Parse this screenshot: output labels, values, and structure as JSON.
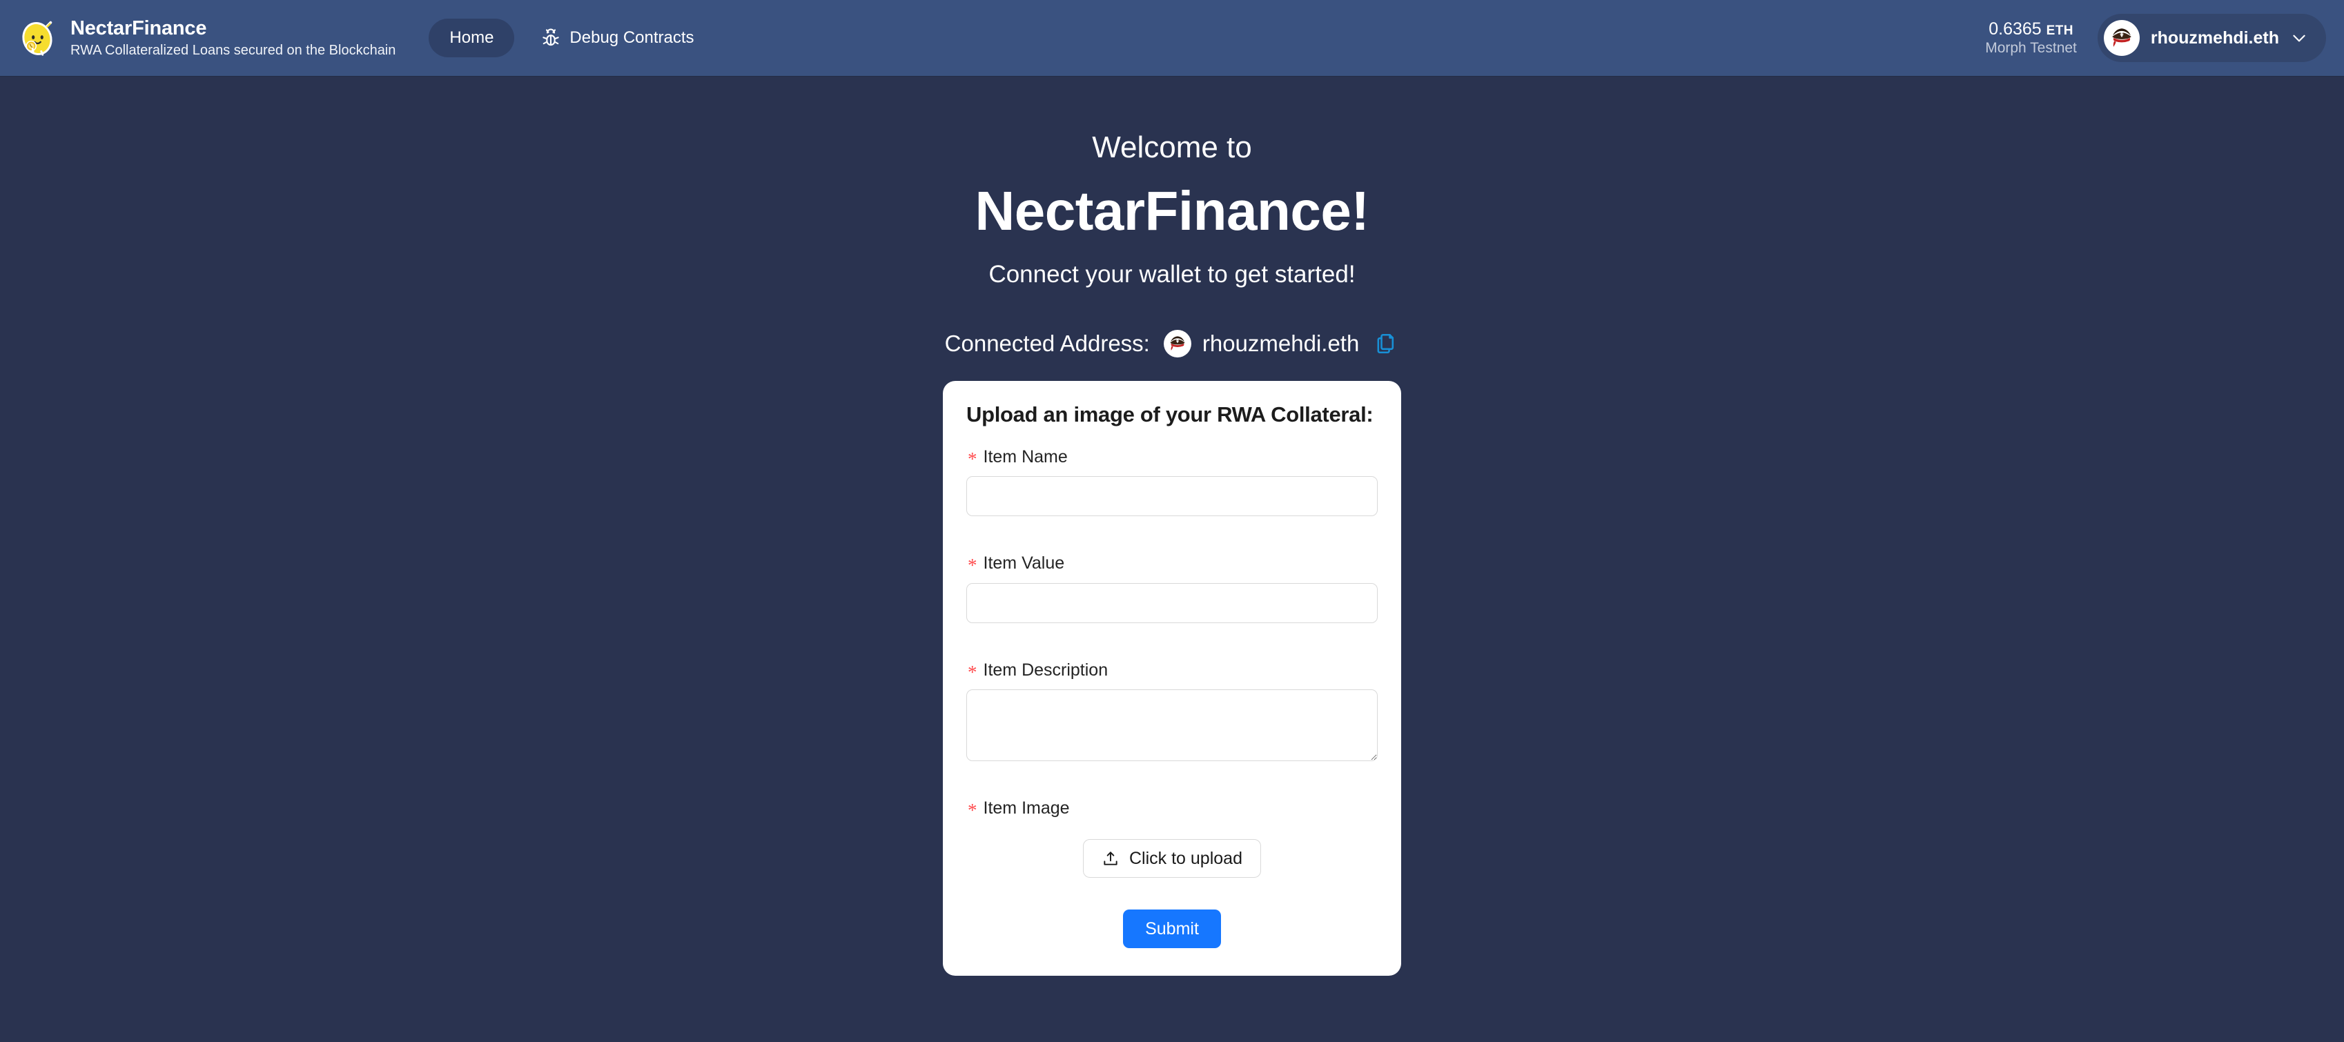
{
  "header": {
    "brand": {
      "logo_icon": "lemon-mascot-logo",
      "title": "NectarFinance",
      "subtitle": "RWA Collateralized Loans secured on the Blockchain"
    },
    "nav": [
      {
        "label": "Home",
        "active": true,
        "icon": null
      },
      {
        "label": "Debug Contracts",
        "active": false,
        "icon": "bug-icon"
      }
    ],
    "balance": {
      "amount": "0.6365",
      "unit": "ETH",
      "network": "Morph Testnet"
    },
    "wallet": {
      "avatar_icon": "pirate-avatar",
      "name": "rhouzmehdi.eth",
      "chevron_icon": "chevron-down-icon"
    }
  },
  "main": {
    "welcome_small": "Welcome to",
    "welcome_big": "NectarFinance!",
    "welcome_tagline": "Connect your wallet to get started!",
    "connected": {
      "label": "Connected Address:",
      "avatar_icon": "pirate-avatar",
      "address": "rhouzmehdi.eth",
      "copy_icon": "copy-icon"
    }
  },
  "form": {
    "title": "Upload an image of your RWA Collateral:",
    "required_marker": "*",
    "fields": [
      {
        "label": "Item Name",
        "value": "",
        "placeholder": "",
        "type": "text"
      },
      {
        "label": "Item Value",
        "value": "",
        "placeholder": "",
        "type": "text"
      },
      {
        "label": "Item Description",
        "value": "",
        "placeholder": "",
        "type": "textarea"
      },
      {
        "label": "Item Image",
        "value": "",
        "placeholder": "",
        "type": "upload"
      }
    ],
    "upload_label": "Click to upload",
    "upload_icon": "upload-icon",
    "submit_label": "Submit"
  },
  "colors": {
    "header_bg": "#3a5280",
    "page_bg": "#2a3350",
    "nav_active_bg": "#2f4168",
    "wallet_pill_bg": "#33466d",
    "primary": "#1677ff",
    "required_red": "#ff4d4f",
    "copy_icon_blue": "#1890d6",
    "card_bg": "#ffffff",
    "input_border": "#d9d9d9"
  }
}
